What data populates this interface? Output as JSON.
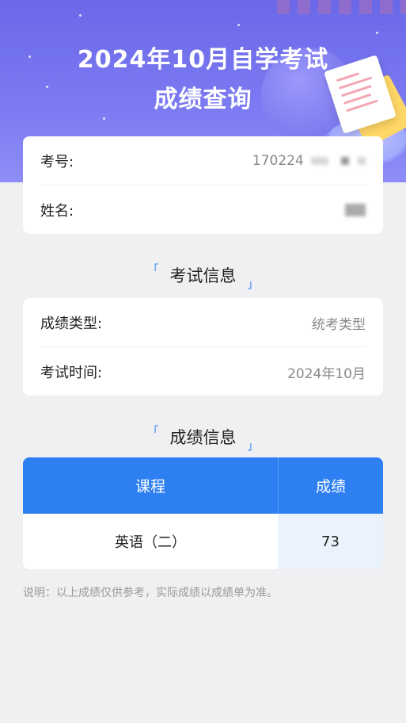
{
  "header": {
    "title_line1": "2024年10月自学考试",
    "title_line2": "成绩查询"
  },
  "candidate": {
    "exam_no_label": "考号:",
    "exam_no_value": "170224",
    "name_label": "姓名:"
  },
  "exam_info": {
    "section_title": "考试信息",
    "type_label": "成绩类型:",
    "type_value": "统考类型",
    "time_label": "考试时间:",
    "time_value": "2024年10月"
  },
  "score_info": {
    "section_title": "成绩信息",
    "columns": [
      "课程",
      "成绩"
    ],
    "rows": [
      {
        "course": "英语（二）",
        "score": "73"
      }
    ]
  },
  "note": "说明：以上成绩仅供参考，实际成绩以成绩单为准。",
  "colors": {
    "banner": "#7472ee",
    "accent": "#2d7ff2",
    "score_cell": "#eaf2fc",
    "background": "#f0f0f2"
  },
  "icons": [
    "exam-paper-illustration",
    "bracket-corner-icon"
  ]
}
